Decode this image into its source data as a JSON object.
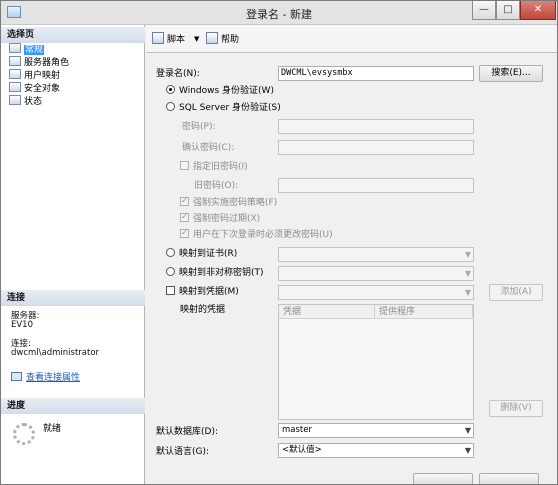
{
  "window": {
    "title": "登录名 - 新建",
    "min": "—",
    "max": "□",
    "close": "✕"
  },
  "left": {
    "select_page_header": "选择页",
    "pages": [
      "常规",
      "服务器角色",
      "用户映射",
      "安全对象",
      "状态"
    ],
    "selected_page": "常规",
    "connection_header": "连接",
    "server_label": "服务器:",
    "server_value": "EV10",
    "connection_label": "连接:",
    "connection_value": "dwcml\\administrator",
    "view_props_link": "查看连接属性",
    "progress_header": "进度",
    "progress_status": "就绪"
  },
  "toolbar": {
    "script_label": "脚本",
    "script_dropdown": "▼",
    "help_label": "帮助"
  },
  "form": {
    "login_name_label": "登录名(N):",
    "login_name_value": "DWCML\\evsysmbx",
    "search_button": "搜索(E)...",
    "windows_auth_label": "Windows 身份验证(W)",
    "sql_auth_label": "SQL Server 身份验证(S)",
    "password_label": "密码(P):",
    "confirm_password_label": "确认密码(C):",
    "specify_old_password_label": "指定旧密码(I)",
    "old_password_label": "旧密码(O):",
    "enforce_policy_label": "强制实施密码策略(F)",
    "enforce_expiration_label": "强制密码过期(X)",
    "must_change_label": "用户在下次登录时必须更改密码(U)",
    "map_cert_label": "映射到证书(R)",
    "map_asym_key_label": "映射到非对称密钥(T)",
    "map_credential_label": "映射到凭据(M)",
    "add_button": "添加(A)",
    "mapped_credentials_label": "映射的凭据",
    "grid_headers": [
      "凭据",
      "提供程序"
    ],
    "remove_button": "删除(V)",
    "default_db_label": "默认数据库(D):",
    "default_db_value": "master",
    "default_lang_label": "默认语言(G):",
    "default_lang_value": "<默认值>"
  }
}
